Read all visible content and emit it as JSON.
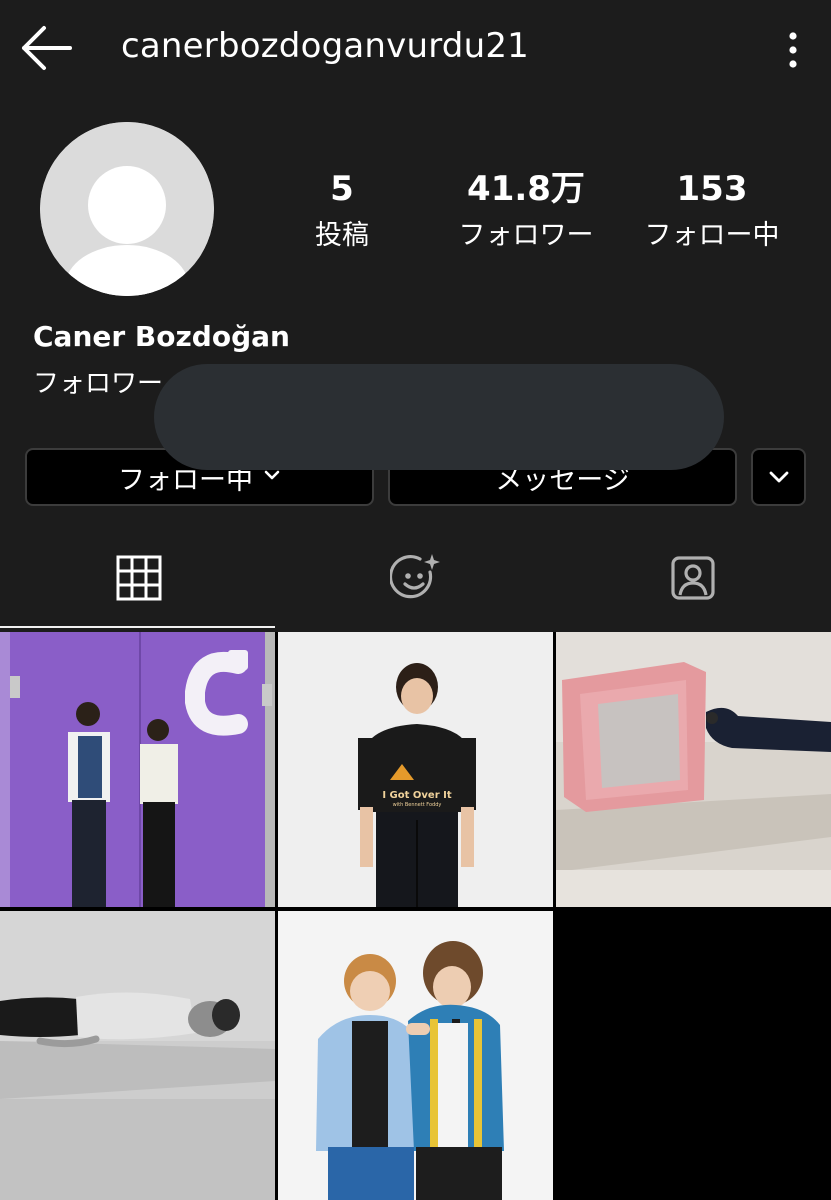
{
  "header": {
    "username": "canerbozdoganvurdu21",
    "back_icon": "arrow-left-icon",
    "more_icon": "vertical-dots-icon"
  },
  "profile": {
    "display_name": "Caner Bozdoğan",
    "followed_by_text": "フォロワー",
    "avatar": "default-avatar-icon"
  },
  "stats": {
    "posts": {
      "value": "5",
      "label": "投稿"
    },
    "followers": {
      "value": "41.8万",
      "label": "フォロワー"
    },
    "following": {
      "value": "153",
      "label": "フォロー中"
    }
  },
  "actions": {
    "following_label": "フォロー中",
    "message_label": "メッセージ"
  },
  "tabs": [
    {
      "name": "posts-grid",
      "icon": "grid-icon",
      "active": true
    },
    {
      "name": "reels",
      "icon": "smiley-sparkle-icon",
      "active": false
    },
    {
      "name": "tagged",
      "icon": "tagged-person-icon",
      "active": false
    }
  ],
  "posts": [
    {
      "scene": "two people standing against a purple door"
    },
    {
      "scene": "person in a black t-shirt against a white wall"
    },
    {
      "scene": "pink box on a stage with legs"
    },
    {
      "scene": "person lying on a stage, monochrome"
    },
    {
      "scene": "two people posing in front of a white wall"
    }
  ],
  "post_texts": {
    "tshirt_line1": "I Got Over It",
    "tshirt_line2": "with Bennett Foddy"
  },
  "colors": {
    "background": "#1c1c1c",
    "text": "#ffffff",
    "button_border": "#3c3c3c",
    "avatar_bg": "#dbdbdb"
  }
}
